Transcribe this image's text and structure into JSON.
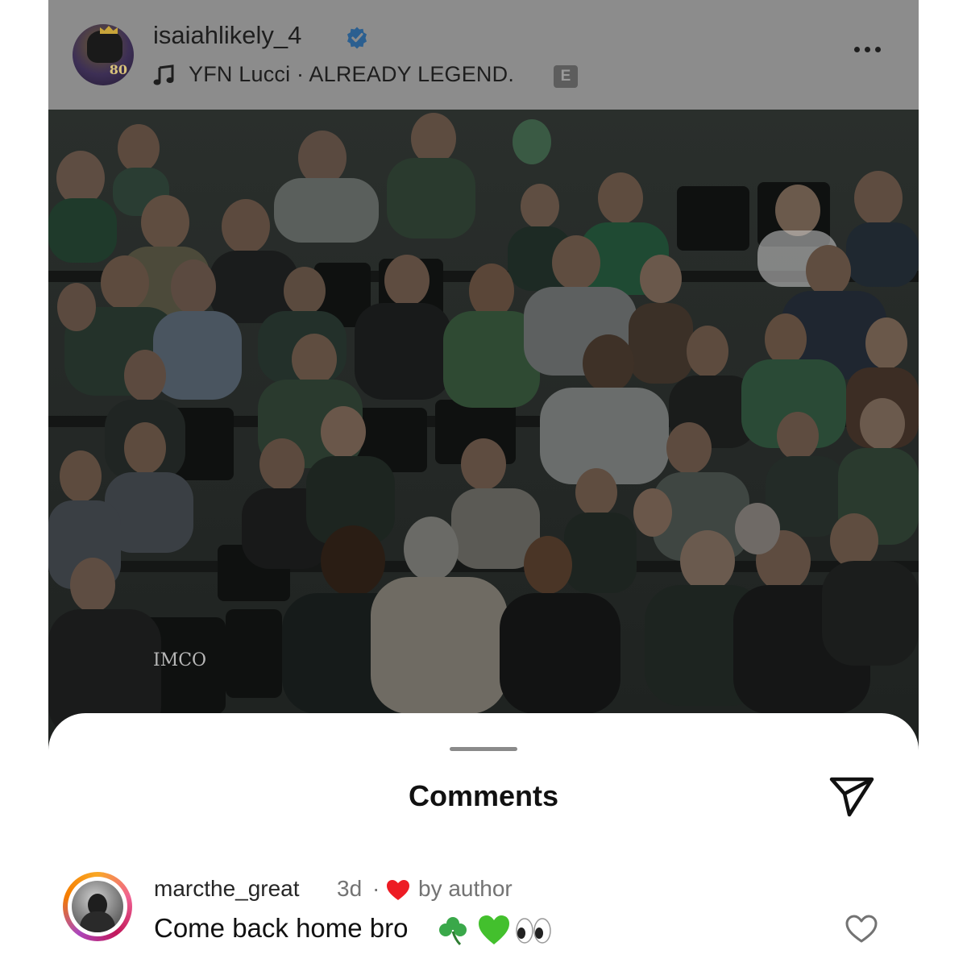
{
  "post": {
    "username": "isaiahlikely_4",
    "verified": true,
    "music": "YFN Lucci · ALREADY LEGEND.",
    "explicit_badge": "E",
    "avatar_number": "80",
    "photo_signage": "IMCO"
  },
  "comments_sheet": {
    "title": "Comments"
  },
  "comments": [
    {
      "username": "marcthe_great",
      "time": "3d",
      "separator": "·",
      "by_author": "by author",
      "text": "Come back home bro"
    }
  ],
  "icons": {
    "music": "music-note-icon",
    "verified": "verified-badge-icon",
    "more": "more-options-icon",
    "send": "send-icon",
    "liked_by_author": "red-heart-icon",
    "like": "heart-outline-icon",
    "emoji": [
      "shamrock-emoji",
      "green-heart-emoji",
      "eyes-emoji"
    ]
  },
  "colors": {
    "verified_blue": "#3897f0",
    "heart_red": "#ed4956",
    "story_ring": "#f06292"
  }
}
